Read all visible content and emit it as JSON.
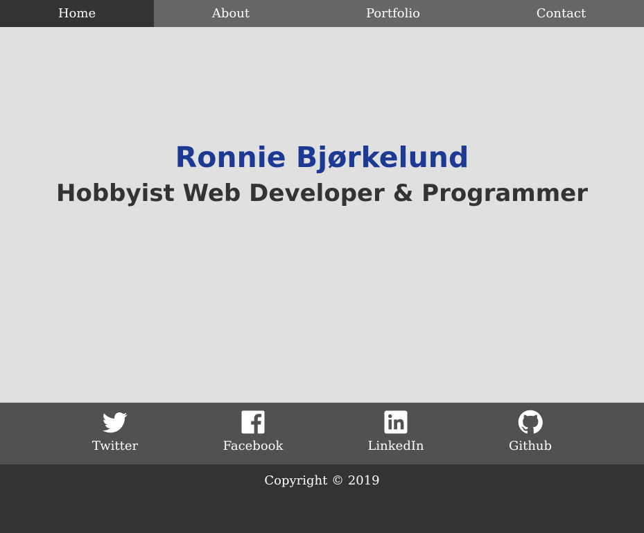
{
  "nav": {
    "items": [
      {
        "label": "Home",
        "active": true
      },
      {
        "label": "About",
        "active": false
      },
      {
        "label": "Portfolio",
        "active": false
      },
      {
        "label": "Contact",
        "active": false
      }
    ]
  },
  "hero": {
    "name": "Ronnie Bjørkelund",
    "title": "Hobbyist Web Developer & Programmer"
  },
  "social": {
    "links": [
      {
        "label": "Twitter",
        "icon": "twitter-icon"
      },
      {
        "label": "Facebook",
        "icon": "facebook-icon"
      },
      {
        "label": "LinkedIn",
        "icon": "linkedin-icon"
      },
      {
        "label": "Github",
        "icon": "github-icon"
      }
    ]
  },
  "footer": {
    "copyright": "Copyright © 2019"
  },
  "colors": {
    "nav_bg": "#666666",
    "nav_active_bg": "#333333",
    "hero_bg": "#e0e0e0",
    "name_color": "#1c3a93",
    "title_color": "#333333",
    "social_bg": "#515151",
    "footer_bg": "#333333"
  }
}
